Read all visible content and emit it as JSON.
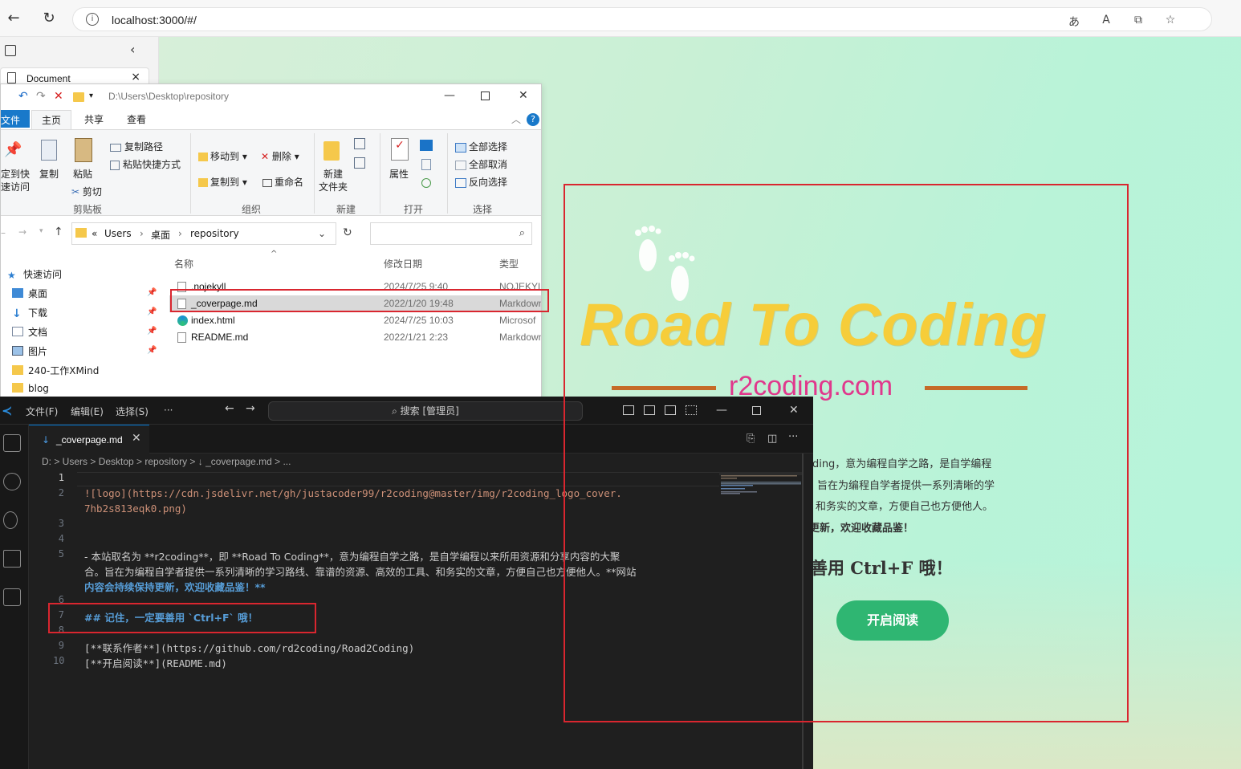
{
  "browser": {
    "url": "localhost:3000/#/",
    "sidebar_tab_title": "Document"
  },
  "cover": {
    "logo_text": "Road To Coding",
    "tagline": "r2coding.com",
    "desc_lines": [
      "oding，意为编程自学之路，是自学编程",
      "旨在为编程自学者提供一系列清晰的学",
      "和务实的文章，方便自己也方便他人。",
      "更新，欢迎收藏品鉴！"
    ],
    "remember": "善用 Ctrl+F 哦！",
    "start_button": "开启阅读"
  },
  "explorer": {
    "path": "D:\\Users\\Desktop\\repository",
    "tabs": {
      "file": "文件",
      "home": "主页",
      "share": "共享",
      "view": "查看"
    },
    "ribbon": {
      "pin_quick": "定到快",
      "pin_quick2": "速访问",
      "copy": "复制",
      "paste": "粘贴",
      "copy_path": "复制路径",
      "paste_shortcut": "粘贴快捷方式",
      "cut": "剪切",
      "move_to": "移动到",
      "copy_to": "复制到",
      "delete": "删除",
      "rename": "重命名",
      "new_folder": "新建",
      "new_folder2": "文件夹",
      "properties": "属性",
      "select_all": "全部选择",
      "select_none": "全部取消",
      "invert_selection": "反向选择",
      "group_clipboard": "剪贴板",
      "group_organize": "组织",
      "group_new": "新建",
      "group_open": "打开",
      "group_select": "选择"
    },
    "breadcrumb": {
      "prefix": "«",
      "users": "Users",
      "desktop": "桌面",
      "repo": "repository"
    },
    "nav": [
      {
        "label": "快速访问"
      },
      {
        "label": "桌面"
      },
      {
        "label": "下载"
      },
      {
        "label": "文档"
      },
      {
        "label": "图片"
      },
      {
        "label": "240-工作XMind"
      },
      {
        "label": "blog"
      }
    ],
    "columns": {
      "name": "名称",
      "date": "修改日期",
      "type": "类型"
    },
    "files": [
      {
        "name": ".nojekyll",
        "date": "2024/7/25 9:40",
        "type": "NOJEKYLL"
      },
      {
        "name": "_coverpage.md",
        "date": "2022/1/20 19:48",
        "type": "Markdown"
      },
      {
        "name": "index.html",
        "date": "2024/7/25 10:03",
        "type": "Microsof"
      },
      {
        "name": "README.md",
        "date": "2022/1/21 2:23",
        "type": "Markdown"
      }
    ]
  },
  "vscode": {
    "menus": [
      "文件(F)",
      "编辑(E)",
      "选择(S)",
      "···"
    ],
    "search": "搜索 [管理员]",
    "tab_name": "_coverpage.md",
    "breadcrumbs": "D: > Users > Desktop > repository > ↓ _coverpage.md > ...",
    "line_numbers": [
      "1",
      "2",
      "",
      "3",
      "4",
      "5",
      "",
      "",
      "6",
      "7",
      "8",
      "9",
      "10"
    ],
    "lines": {
      "l2a": "![logo](https://cdn.jsdelivr.net/gh/justacoder99/r2coding@master/img/r2coding_logo_cover.",
      "l2b": "7hb2s813eqk0.png)",
      "l5a": "- 本站取名为 **r2coding**，即 **Road To Coding**，意为编程自学之路，是自学编程以来所用资源和分享内容的大聚",
      "l5b": "合。旨在为编程自学者提供一系列清晰的学习路线、靠谱的资源、高效的工具、和务实的文章，方便自己也方便他人。**网站",
      "l5c": "内容会持续保持更新，欢迎收藏品鉴！**",
      "l7": "## 记住，一定要善用 `Ctrl+F` 哦！",
      "l9": "[**联系作者**](https://github.com/rd2coding/Road2Coding)",
      "l10": "[**开启阅读**](README.md)"
    }
  },
  "colors": {
    "annotation_red": "#d9262f",
    "logo_yellow": "#f6cd3a",
    "tagline_pink": "#e0388c",
    "button_green": "#2fb672",
    "explorer_blue": "#1979ca"
  }
}
